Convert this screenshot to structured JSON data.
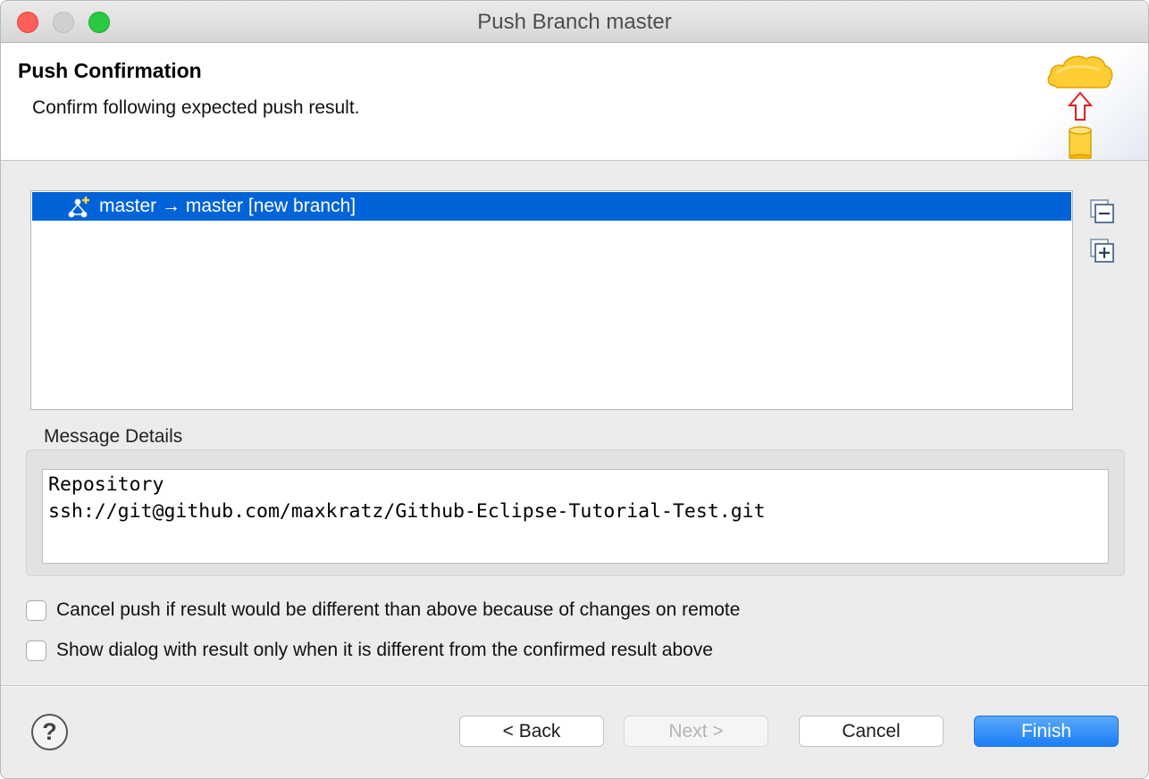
{
  "window": {
    "title": "Push Branch master"
  },
  "banner": {
    "title": "Push Confirmation",
    "description": "Confirm following expected push result.",
    "icon": "push-cloud-icon"
  },
  "tree": {
    "rows": [
      {
        "label": "master → master [new branch]",
        "icon": "new-branch-icon",
        "selected": true
      }
    ],
    "collapse_icon": "collapse-all-icon",
    "expand_icon": "expand-all-icon"
  },
  "message_details": {
    "label": "Message Details",
    "lines": [
      "Repository",
      "ssh://git@github.com/maxkratz/Github-Eclipse-Tutorial-Test.git"
    ]
  },
  "options": [
    {
      "label": "Cancel push if result would be different than above because of changes on remote",
      "checked": false
    },
    {
      "label": "Show dialog with result only when it is different from the confirmed result above",
      "checked": false
    }
  ],
  "footer": {
    "help_icon": "help-icon",
    "help_glyph": "?",
    "back_label": "< Back",
    "next_label": "Next >",
    "cancel_label": "Cancel",
    "finish_label": "Finish"
  },
  "colors": {
    "selection": "#0063d8",
    "finish_button": "#1b7ef6",
    "close": "#fc5f57",
    "maximize": "#2ac940"
  }
}
